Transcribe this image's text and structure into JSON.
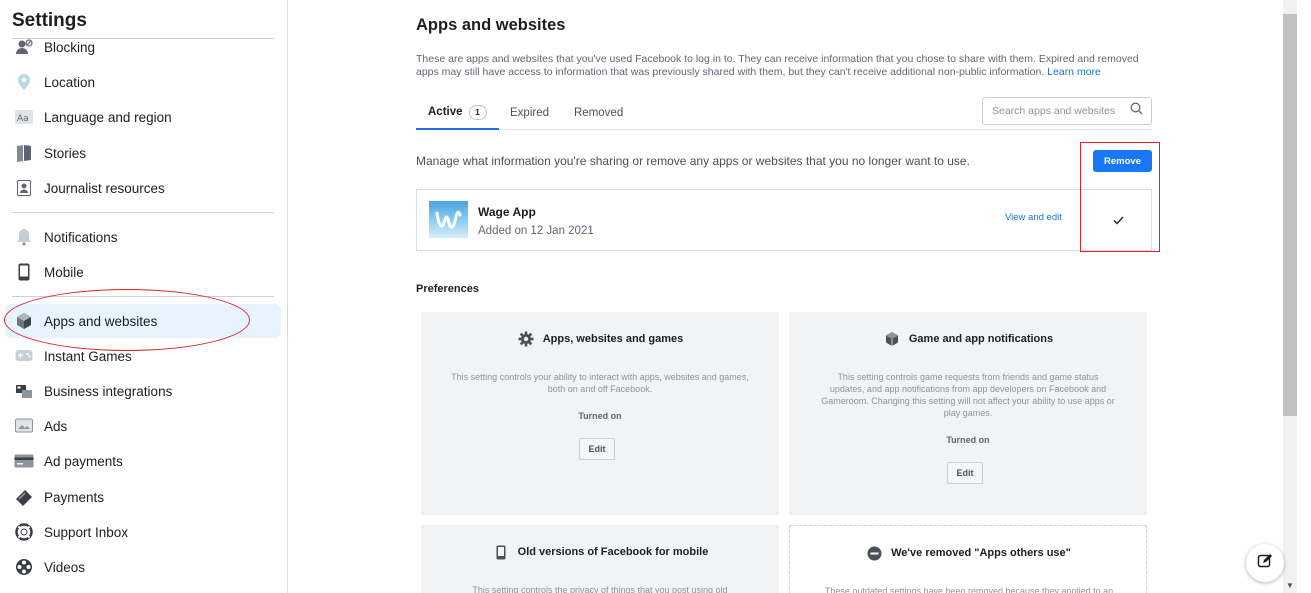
{
  "sidebar": {
    "title": "Settings",
    "items": [
      {
        "label": "Blocking",
        "icon": "blocking-icon"
      },
      {
        "label": "Location",
        "icon": "location-icon"
      },
      {
        "label": "Language and region",
        "icon": "language-icon"
      },
      {
        "label": "Stories",
        "icon": "stories-icon"
      },
      {
        "label": "Journalist resources",
        "icon": "journalist-icon"
      },
      {
        "label": "Notifications",
        "icon": "bell-icon"
      },
      {
        "label": "Mobile",
        "icon": "mobile-icon"
      },
      {
        "label": "Apps and websites",
        "icon": "apps-icon"
      },
      {
        "label": "Instant Games",
        "icon": "games-icon"
      },
      {
        "label": "Business integrations",
        "icon": "business-icon"
      },
      {
        "label": "Ads",
        "icon": "ads-icon"
      },
      {
        "label": "Ad payments",
        "icon": "card-icon"
      },
      {
        "label": "Payments",
        "icon": "payments-icon"
      },
      {
        "label": "Support Inbox",
        "icon": "lifebuoy-icon"
      },
      {
        "label": "Videos",
        "icon": "film-icon"
      }
    ],
    "active": "Apps and websites"
  },
  "main": {
    "title": "Apps and websites",
    "intro": "These are apps and websites that you've used Facebook to log in to. They can receive information that you chose to share with them. Expired and removed apps may still have access to information that was previously shared with them, but they can't receive additional non-public information.",
    "learn_more": "Learn more",
    "tabs": [
      {
        "label": "Active",
        "badge": "1"
      },
      {
        "label": "Expired"
      },
      {
        "label": "Removed"
      }
    ],
    "search_placeholder": "Search apps and websites",
    "manage_text": "Manage what information you're sharing or remove any apps or websites that you no longer want to use.",
    "remove_label": "Remove",
    "app": {
      "name": "Wage App",
      "added": "Added on 12 Jan 2021",
      "view_edit": "View and edit",
      "checked": true
    },
    "preferences_title": "Preferences",
    "preferences": [
      {
        "title": "Apps, websites and games",
        "icon": "gear-icon",
        "desc": "This setting controls your ability to interact with apps, websites and games, both on and off Facebook.",
        "status": "Turned on",
        "edit": "Edit"
      },
      {
        "title": "Game and app notifications",
        "icon": "cube-icon",
        "desc": "This setting controls game requests from friends and game status updates, and app notifications from app developers on Facebook and Gameroom. Changing this setting will not affect your ability to use apps or play games.",
        "status": "Turned on",
        "edit": "Edit"
      },
      {
        "title": "Old versions of Facebook for mobile",
        "icon": "phone-icon",
        "desc": "This setting controls the privacy of things that you post using old"
      },
      {
        "title": "We've removed \"Apps others use\"",
        "icon": "minus-circle-icon",
        "desc": "These outdated settings have been removed because they applied to an"
      }
    ]
  },
  "colors": {
    "accent": "#1877f2",
    "link": "#216fdb",
    "annotation": "#e02020"
  }
}
